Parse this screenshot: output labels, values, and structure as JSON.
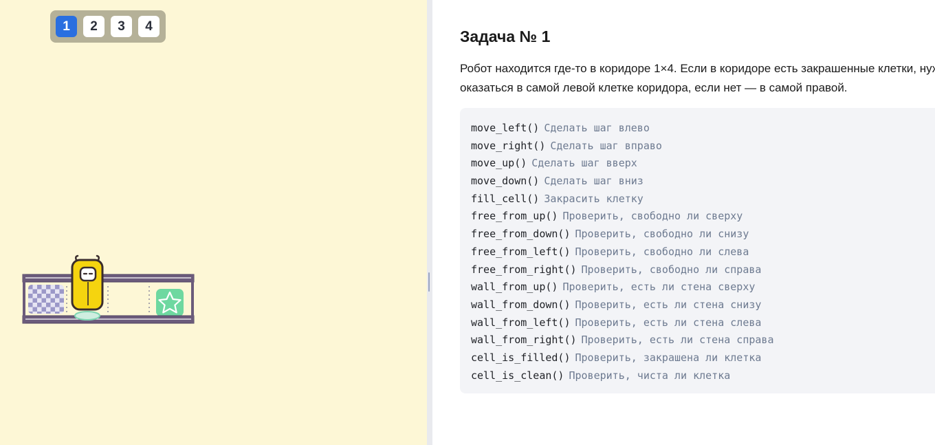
{
  "task_tabs": [
    {
      "label": "1",
      "active": true
    },
    {
      "label": "2",
      "active": false
    },
    {
      "label": "3",
      "active": false
    },
    {
      "label": "4",
      "active": false
    }
  ],
  "field": {
    "grid": "1x4",
    "cells": [
      "filled",
      "robot",
      "empty",
      "target-star"
    ]
  },
  "task": {
    "title": "Задача № 1",
    "description": "Робот находится где-то в коридоре 1×4. Если в коридоре есть закрашенные клетки, нужно оказаться в самой левой клетке коридора, если нет — в самой правой."
  },
  "commands": [
    {
      "name": "move_left()",
      "desc": "Сделать шаг влево"
    },
    {
      "name": "move_right()",
      "desc": "Сделать шаг вправо"
    },
    {
      "name": "move_up()",
      "desc": "Сделать шаг вверх"
    },
    {
      "name": "move_down()",
      "desc": "Сделать шаг вниз"
    },
    {
      "name": "fill_cell()",
      "desc": "Закрасить клетку"
    },
    {
      "name": "free_from_up()",
      "desc": "Проверить, свободно ли сверху"
    },
    {
      "name": "free_from_down()",
      "desc": "Проверить, свободно ли снизу"
    },
    {
      "name": "free_from_left()",
      "desc": "Проверить, свободно ли слева"
    },
    {
      "name": "free_from_right()",
      "desc": "Проверить, свободно ли справа"
    },
    {
      "name": "wall_from_up()",
      "desc": "Проверить, есть ли стена сверху"
    },
    {
      "name": "wall_from_down()",
      "desc": "Проверить, есть ли стена снизу"
    },
    {
      "name": "wall_from_left()",
      "desc": "Проверить, есть ли стена слева"
    },
    {
      "name": "wall_from_right()",
      "desc": "Проверить, есть ли стена справа"
    },
    {
      "name": "cell_is_filled()",
      "desc": "Проверить, закрашена ли клетка"
    },
    {
      "name": "cell_is_clean()",
      "desc": "Проверить, чиста ли клетка"
    }
  ],
  "colors": {
    "field_background": "#fdf7d6",
    "active_tab": "#2a6fe0",
    "wall": "#6b5b7b",
    "robot": "#f5d40f",
    "target": "#6ed8a0",
    "filled_cell": "#9b98c8"
  }
}
